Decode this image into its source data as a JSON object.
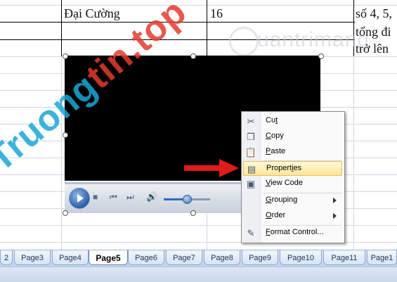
{
  "sheet": {
    "rows": [
      {
        "name": "Đại Cường",
        "value": "16",
        "note": "số 4, 5,"
      },
      {
        "note": "tổng đi"
      },
      {
        "note": "trở lên"
      }
    ]
  },
  "context_menu": {
    "items": [
      {
        "label": "Cut",
        "accel": "t",
        "icon": "scissors-icon"
      },
      {
        "label": "Copy",
        "accel": "C",
        "icon": "copy-icon"
      },
      {
        "label": "Paste",
        "accel": "P",
        "icon": "paste-icon"
      },
      {
        "label": "Properties",
        "accel": "i",
        "icon": "properties-icon",
        "highlighted": true
      },
      {
        "label": "View Code",
        "accel": "V",
        "icon": "view-code-icon"
      },
      {
        "label": "Grouping",
        "accel": "G",
        "submenu": true
      },
      {
        "label": "Order",
        "accel": "O",
        "submenu": true
      },
      {
        "label": "Format Control...",
        "accel": "F",
        "icon": "format-control-icon"
      }
    ]
  },
  "sheet_tabs": {
    "tabs": [
      "2",
      "Page3",
      "Page4",
      "Page5",
      "Page6",
      "Page7",
      "Page8",
      "Page9",
      "Page10",
      "Page11",
      "Page1"
    ],
    "active": "Page5"
  },
  "media_player": {
    "volume_level": 0.5
  },
  "watermark": {
    "logo_text": "uantrimang",
    "big_part1": "Truong",
    "big_part2": "tin.top"
  },
  "colors": {
    "highlight": "#ffe79a",
    "arrow": "#e01b1b",
    "watermark_blue": "#1aa8d8",
    "watermark_red": "#e33b2e"
  }
}
